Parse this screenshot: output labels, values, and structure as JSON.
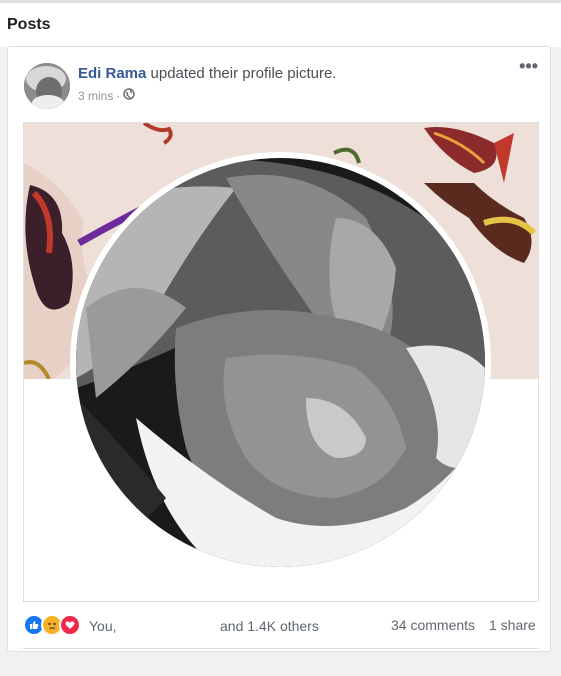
{
  "section": {
    "title": "Posts"
  },
  "post": {
    "author": "Edi Rama",
    "action": " updated their profile picture.",
    "time": "3 mins",
    "separator": "·",
    "privacy_icon": "globe-icon",
    "more_icon": "ellipsis-icon",
    "more_label": "•••"
  },
  "stats": {
    "reactions": [
      "like-icon",
      "sad-icon",
      "love-icon"
    ],
    "reactor": "You,",
    "others": "and 1.4K others",
    "comments": "34 comments",
    "shares": "1 share"
  },
  "colors": {
    "link": "#365899",
    "like": "#1877f2",
    "love": "#f0284a",
    "sad": "#f7b125"
  }
}
